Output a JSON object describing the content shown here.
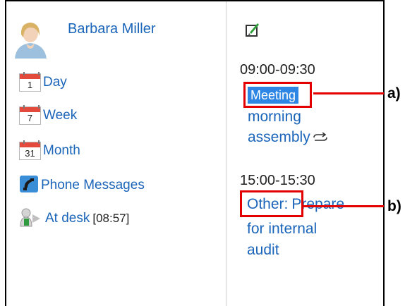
{
  "user": {
    "name": "Barbara Miller"
  },
  "menu": {
    "day": {
      "label": "Day",
      "icon_number": "1"
    },
    "week": {
      "label": "Week",
      "icon_number": "7"
    },
    "month": {
      "label": "Month",
      "icon_number": "31"
    },
    "phone": {
      "label": "Phone Messages"
    },
    "presence": {
      "label": "At desk",
      "time": "[08:57]"
    }
  },
  "events": [
    {
      "time": "09:00-09:30",
      "badge": "Meeting",
      "title_line1": "morning",
      "title_line2": "assembly"
    },
    {
      "time": "15:00-15:30",
      "prefix": "Other:",
      "title_line1": "Prepare",
      "title_line2": "for internal",
      "title_line3": "audit"
    }
  ],
  "callouts": {
    "a": "a)",
    "b": "b)"
  },
  "colors": {
    "link": "#1a64b9",
    "badge": "#2d86e3",
    "callout": "#e30000"
  }
}
